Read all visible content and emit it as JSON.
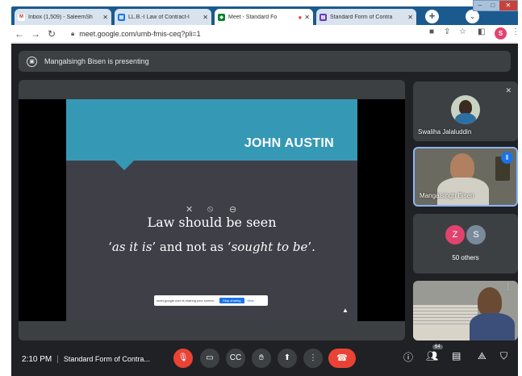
{
  "browser": {
    "tabs": [
      {
        "favicon": "M",
        "favicon_color": "#d93025",
        "title": "Inbox (1,509) - SaleemSh",
        "active": false
      },
      {
        "favicon": "▤",
        "favicon_color": "#1a73e8",
        "title": "LL.B.-I Law of Contract-I",
        "active": false
      },
      {
        "favicon": "◆",
        "favicon_color": "#00832d",
        "title": "Meet - Standard Fo",
        "active": true
      },
      {
        "favicon": "▤",
        "favicon_color": "#673ab7",
        "title": "Standard Form of Contra",
        "active": false
      }
    ],
    "url": "meet.google.com/umb-fmis-ceq?pli=1",
    "profile_letter": "S"
  },
  "meet": {
    "presenting_banner": "Mangalsingh Bisen is presenting",
    "slide": {
      "title": "JOHN AUSTIN",
      "line1": "Law should be seen",
      "line2_pre": "‘",
      "line2_em1": "as it is",
      "line2_mid": "’ and not as ‘",
      "line2_em2": "sought to be",
      "line2_post": "’."
    },
    "share_bar": {
      "text": "meet.google.com is sharing your screen.",
      "stop": "Stop sharing",
      "hide": "Hide"
    },
    "participants": [
      {
        "name": "Swaliha Jalaluddin"
      },
      {
        "name": "Mangalsingh Bisen"
      }
    ],
    "others": {
      "avatars": [
        "Z",
        "S"
      ],
      "avatar_colors": [
        "#e0436e",
        "#7a8a9a"
      ],
      "label": "50 others"
    },
    "time": "2:10 PM",
    "meeting_name": "Standard Form of Contra...",
    "people_count": "64"
  }
}
